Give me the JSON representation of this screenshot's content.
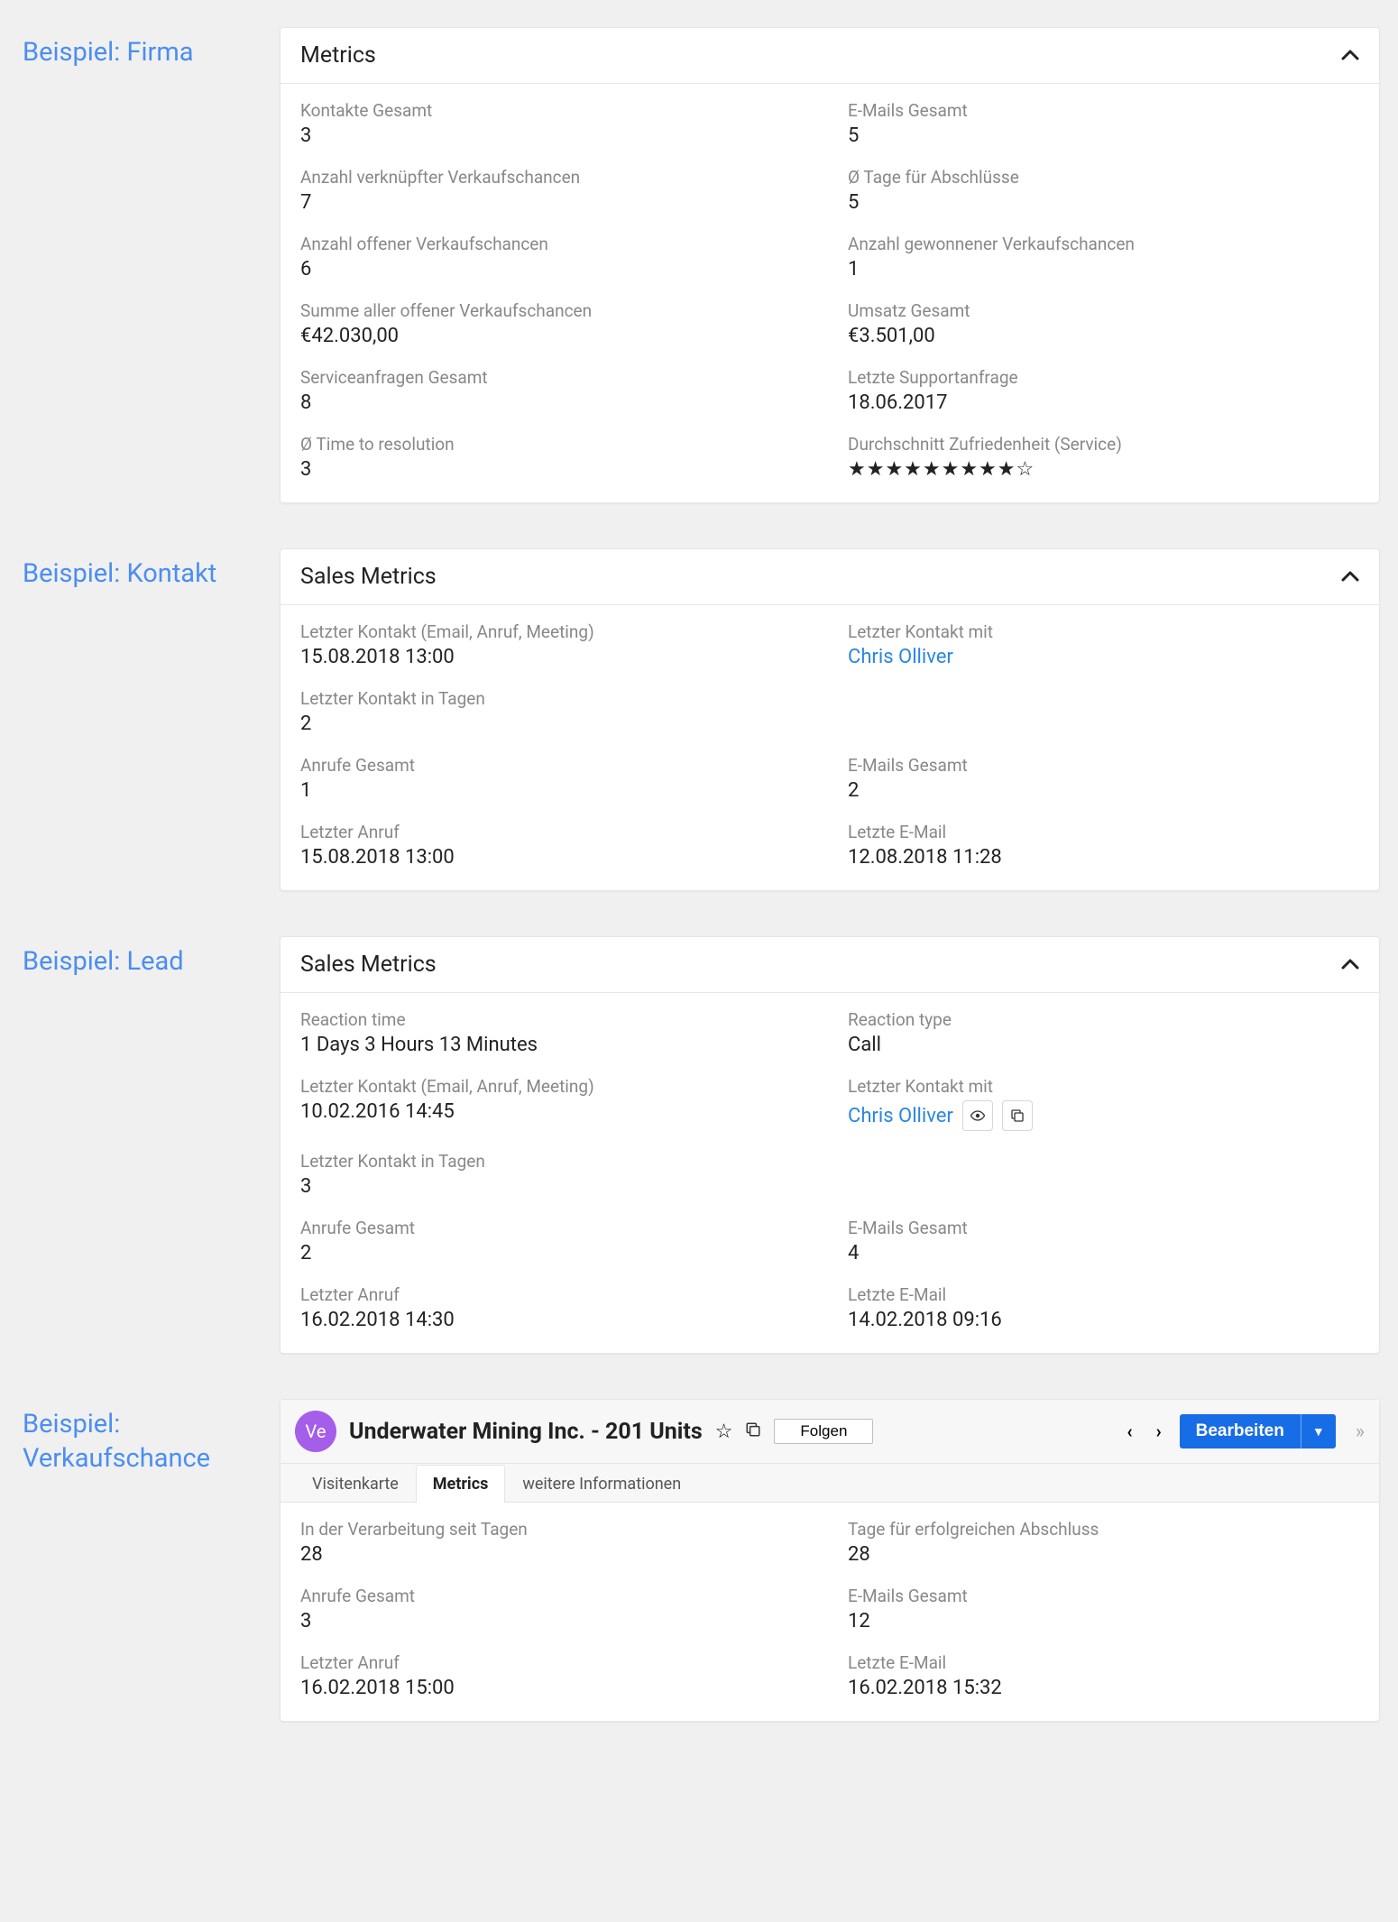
{
  "sections": {
    "firma": {
      "label": "Beispiel: Firma",
      "panel_title": "Metrics",
      "metrics": {
        "kontakte_gesamt": {
          "label": "Kontakte Gesamt",
          "value": "3"
        },
        "emails_gesamt": {
          "label": "E-Mails Gesamt",
          "value": "5"
        },
        "anzahl_verknuepfter": {
          "label": "Anzahl verknüpfter Verkaufschancen",
          "value": "7"
        },
        "avg_tage_abschluesse": {
          "label": "Ø Tage für Abschlüsse",
          "value": "5"
        },
        "anzahl_offener": {
          "label": "Anzahl offener Verkaufschancen",
          "value": "6"
        },
        "anzahl_gewonnener": {
          "label": "Anzahl gewonnener Verkaufschancen",
          "value": "1"
        },
        "summe_offener": {
          "label": "Summe aller offener Verkaufschancen",
          "value": "€42.030,00"
        },
        "umsatz_gesamt": {
          "label": "Umsatz Gesamt",
          "value": "€3.501,00"
        },
        "serviceanfragen": {
          "label": "Serviceanfragen Gesamt",
          "value": "8"
        },
        "letzte_supportanfrage": {
          "label": "Letzte Supportanfrage",
          "value": "18.06.2017"
        },
        "avg_time_resolution": {
          "label": "Ø Time to resolution",
          "value": "3"
        },
        "durchschnitt_zufriedenheit": {
          "label": "Durchschnitt Zufriedenheit (Service)",
          "stars_filled": 9,
          "stars_total": 10
        }
      }
    },
    "kontakt": {
      "label": "Beispiel: Kontakt",
      "panel_title": "Sales Metrics",
      "metrics": {
        "letzter_kontakt": {
          "label": "Letzter Kontakt (Email, Anruf, Meeting)",
          "value": "15.08.2018 13:00"
        },
        "letzter_kontakt_mit": {
          "label": "Letzter Kontakt mit",
          "value": "Chris Olliver"
        },
        "letzter_kontakt_tagen": {
          "label": "Letzter Kontakt in Tagen",
          "value": "2"
        },
        "anrufe_gesamt": {
          "label": "Anrufe Gesamt",
          "value": "1"
        },
        "emails_gesamt": {
          "label": "E-Mails Gesamt",
          "value": "2"
        },
        "letzter_anruf": {
          "label": "Letzter Anruf",
          "value": "15.08.2018 13:00"
        },
        "letzte_email": {
          "label": "Letzte E-Mail",
          "value": "12.08.2018 11:28"
        }
      }
    },
    "lead": {
      "label": "Beispiel: Lead",
      "panel_title": "Sales Metrics",
      "metrics": {
        "reaction_time": {
          "label": "Reaction time",
          "value": "1 Days 3 Hours 13 Minutes"
        },
        "reaction_type": {
          "label": "Reaction type",
          "value": "Call"
        },
        "letzter_kontakt": {
          "label": "Letzter Kontakt (Email, Anruf, Meeting)",
          "value": "10.02.2016 14:45"
        },
        "letzter_kontakt_mit": {
          "label": "Letzter Kontakt mit",
          "value": "Chris Olliver"
        },
        "letzter_kontakt_tagen": {
          "label": "Letzter Kontakt in Tagen",
          "value": "3"
        },
        "anrufe_gesamt": {
          "label": "Anrufe Gesamt",
          "value": "2"
        },
        "emails_gesamt": {
          "label": "E-Mails Gesamt",
          "value": "4"
        },
        "letzter_anruf": {
          "label": "Letzter Anruf",
          "value": "16.02.2018 14:30"
        },
        "letzte_email": {
          "label": "Letzte E-Mail",
          "value": "14.02.2018 09:16"
        }
      }
    },
    "verkaufschance": {
      "label": "Beispiel: Verkaufschance",
      "avatar": "Ve",
      "title": "Underwater Mining Inc. - 201 Units",
      "follow_label": "Folgen",
      "edit_label": "Bearbeiten",
      "tabs": {
        "visitenkarte": "Visitenkarte",
        "metrics": "Metrics",
        "weitere": "weitere Informationen"
      },
      "metrics": {
        "in_verarbeitung": {
          "label": "In der Verarbeitung seit Tagen",
          "value": "28"
        },
        "tage_abschluss": {
          "label": "Tage für erfolgreichen Abschluss",
          "value": "28"
        },
        "anrufe_gesamt": {
          "label": "Anrufe Gesamt",
          "value": "3"
        },
        "emails_gesamt": {
          "label": "E-Mails Gesamt",
          "value": "12"
        },
        "letzter_anruf": {
          "label": "Letzter Anruf",
          "value": "16.02.2018 15:00"
        },
        "letzte_email": {
          "label": "Letzte E-Mail",
          "value": "16.02.2018 15:32"
        }
      }
    }
  }
}
